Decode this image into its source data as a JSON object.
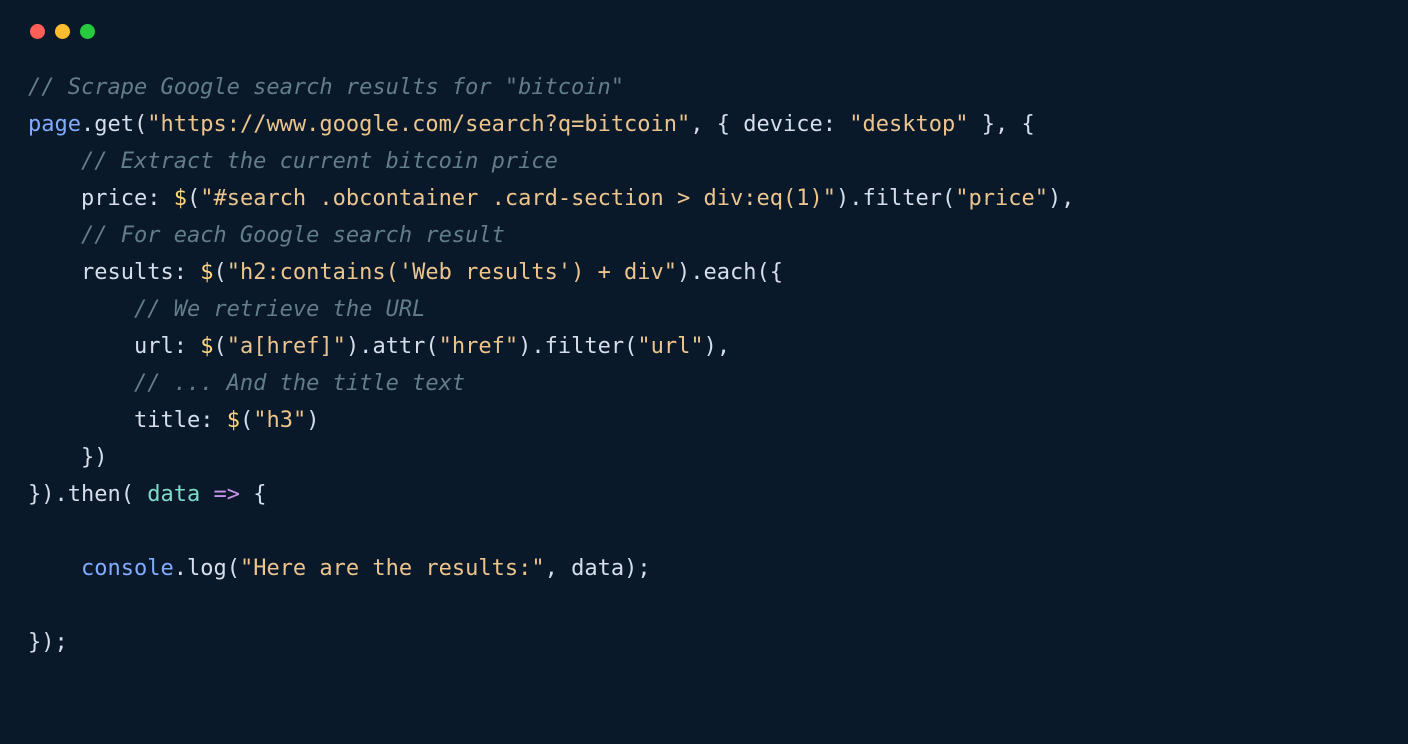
{
  "code": {
    "c1": "// Scrape Google search results for \"bitcoin\"",
    "l2_page": "page",
    "l2_get": "get",
    "l2_url": "\"https://www.google.com/search?q=bitcoin\"",
    "l2_device_key": "device",
    "l2_device_val": "\"desktop\"",
    "c3": "// Extract the current bitcoin price",
    "l4_price": "price",
    "l4_sel": "\"#search .obcontainer .card-section > div:eq(1)\"",
    "l4_filter": "filter",
    "l4_filter_arg": "\"price\"",
    "c5": "// For each Google search result",
    "l6_results": "results",
    "l6_sel": "\"h2:contains('Web results') + div\"",
    "l6_each": "each",
    "c7": "// We retrieve the URL",
    "l8_url": "url",
    "l8_sel": "\"a[href]\"",
    "l8_attr": "attr",
    "l8_attr_arg": "\"href\"",
    "l8_filter": "filter",
    "l8_filter_arg": "\"url\"",
    "c9": "// ... And the title text",
    "l10_title": "title",
    "l10_sel": "\"h3\"",
    "l12_then": "then",
    "l12_data": "data",
    "l14_console": "console",
    "l14_log": "log",
    "l14_msg": "\"Here are the results:\"",
    "l14_data": "data",
    "dollar": "$"
  }
}
